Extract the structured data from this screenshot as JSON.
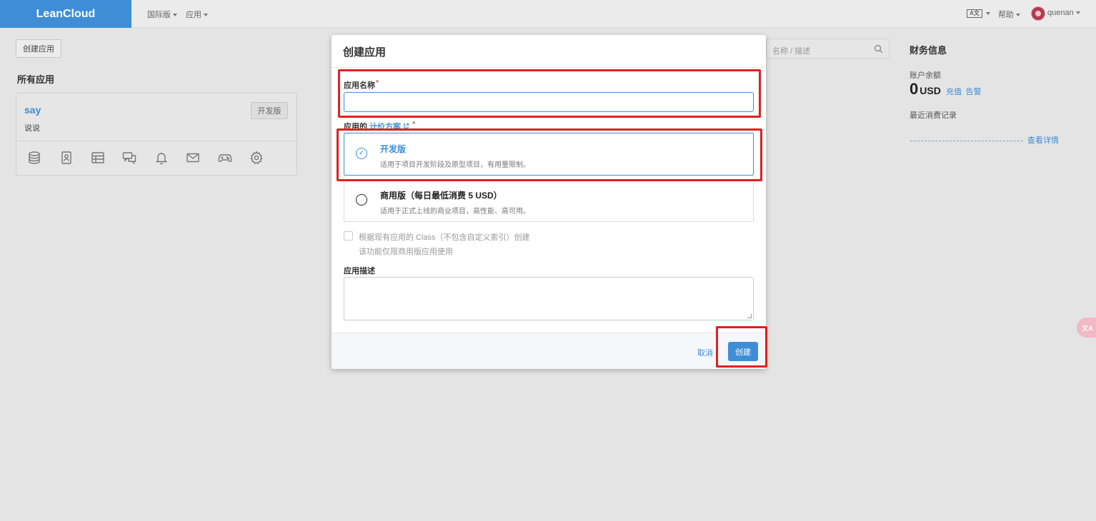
{
  "nav": {
    "logo": "LeanCloud",
    "items": [
      "国际版",
      "应用"
    ],
    "lang_icon": "A文",
    "help": "帮助",
    "user": "quenan"
  },
  "left": {
    "create_button": "创建应用",
    "section_title": "所有应用",
    "app": {
      "name": "say",
      "description": "说说",
      "badge": "开发版",
      "icons": [
        "database-icon",
        "contact-card-icon",
        "table-icon",
        "chat-icon",
        "bell-icon",
        "mail-icon",
        "gamepad-icon",
        "gear-icon"
      ]
    }
  },
  "right": {
    "search_placeholder": "名称 / 描述",
    "finance_title": "财务信息",
    "balance_label": "账户余额",
    "balance_value": "0",
    "balance_unit": "USD",
    "recharge": "充值",
    "alert": "告警",
    "recent_label": "最近消费记录",
    "details_link": "查看详情"
  },
  "float_btn": "文A",
  "modal": {
    "title": "创建应用",
    "name_label": "应用名称",
    "name_value": "",
    "plan_label_prefix": "应用的",
    "plan_link": "计价方案",
    "plans": [
      {
        "title": "开发版",
        "desc": "适用于项目开发阶段及原型项目，有用量限制。",
        "selected": true
      },
      {
        "title": "商用版（每日最低消费 5 USD）",
        "desc": "适用于正式上线的商业项目，高性能、高可用。",
        "selected": false
      }
    ],
    "clone_text": "根据现有应用的 Class（不包含自定义索引）创建",
    "clone_note": "该功能仅限商用版应用使用",
    "desc_label": "应用描述",
    "desc_value": "",
    "cancel": "取消",
    "create": "创建"
  },
  "colors": {
    "accent": "#3d8ed6",
    "highlight": "#e02020",
    "background": "#e4e4e4"
  }
}
